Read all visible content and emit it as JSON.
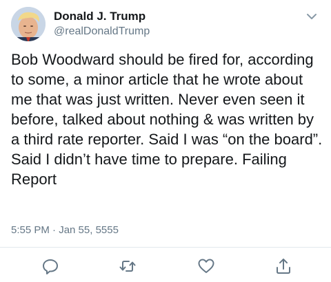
{
  "author": {
    "display_name": "Donald J. Trump",
    "handle": "@realDonaldTrump"
  },
  "tweet": {
    "text": "Bob Woodward should be fired for, according to some, a minor article that he wrote about me that was just written. Never even seen it before, talked about nothing & was written by a third rate reporter. Said I was “on the board”. Said I didn’t have time to prepare. Failing Report",
    "timestamp": "5:55 PM · Jan 55, 5555"
  },
  "icons": {
    "menu": "chevron-down-icon",
    "reply": "reply-icon",
    "retweet": "retweet-icon",
    "like": "heart-icon",
    "share": "share-icon"
  },
  "colors": {
    "text": "#14171a",
    "secondary": "#657786",
    "icon": "#657786",
    "divider": "#e1e8ed"
  }
}
